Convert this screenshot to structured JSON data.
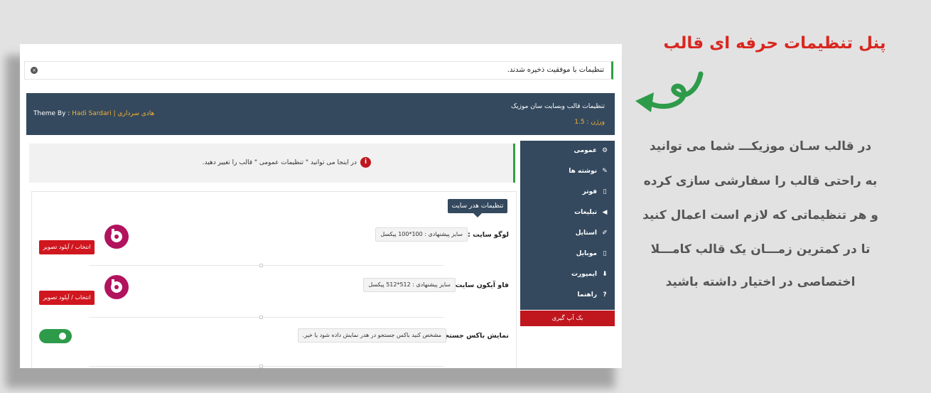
{
  "notice": {
    "text": "تنظیمات با موفقیت ذخیره شدند.",
    "close": "×"
  },
  "header": {
    "title": "تنظیمات قالب وبسایت سان موزیک",
    "version": "ورژن : 1.5",
    "theme_by_prefix": "Theme By : ",
    "theme_by_author": "Hadi Sardari | هادی سرداری"
  },
  "info": {
    "icon": "i",
    "text": "در اینجا می توانید \" تنظیمات عمومی \" قالب را تغییر دهید."
  },
  "section": {
    "title": "تنظیمات هدر سایت"
  },
  "fields": [
    {
      "label": "لوگو سایت :",
      "hint": "سایز پیشنهادی : 100*100 پیکسل",
      "button": "انتخاب / آپلود تصویر"
    },
    {
      "label": "فاو آیکون سایت :",
      "hint": "سایز پیشنهادی : 512*512 پیکسل",
      "button": "انتخاب / آپلود تصویر"
    },
    {
      "label": "نمایش باکس جستجو :",
      "hint": "مشخص کنید باکس جستجو در هدر نمایش داده شود یا خیر.",
      "toggle_on": true
    }
  ],
  "sidebar": {
    "items": [
      {
        "label": "عمومی",
        "icon": "gears-icon",
        "glyph": "⚙"
      },
      {
        "label": "نوشته ها",
        "icon": "edit-icon",
        "glyph": "✎"
      },
      {
        "label": "فوتر",
        "icon": "page-icon",
        "glyph": "▯"
      },
      {
        "label": "تبلیغات",
        "icon": "megaphone-icon",
        "glyph": "◀"
      },
      {
        "label": "استایل",
        "icon": "brush-icon",
        "glyph": "✐"
      },
      {
        "label": "موبایل",
        "icon": "mobile-icon",
        "glyph": "▯"
      },
      {
        "label": "ایمپورت",
        "icon": "download-icon",
        "glyph": "⬇"
      },
      {
        "label": "راهنما",
        "icon": "question-icon",
        "glyph": "?"
      }
    ],
    "backup_label": "بک آپ گیری"
  },
  "promo": {
    "title": "پنل تنظیمات حرفه ای قالب",
    "lines": [
      "در قالب سـان موزیکـــ شما می توانید",
      "به راحتی  قالب  را سفارشی سازی کرده",
      "و هر تنظیماتی که لازم است اعمال کنید",
      "تا  در کمترین زمـــان یک  قالب کامـــلا",
      "اختصاصی در اختیار داشته باشید"
    ]
  },
  "colors": {
    "accent_red": "#d9261f",
    "header_bg": "#34495e",
    "success_green": "#2ea043",
    "version_orange": "#f5b335"
  }
}
